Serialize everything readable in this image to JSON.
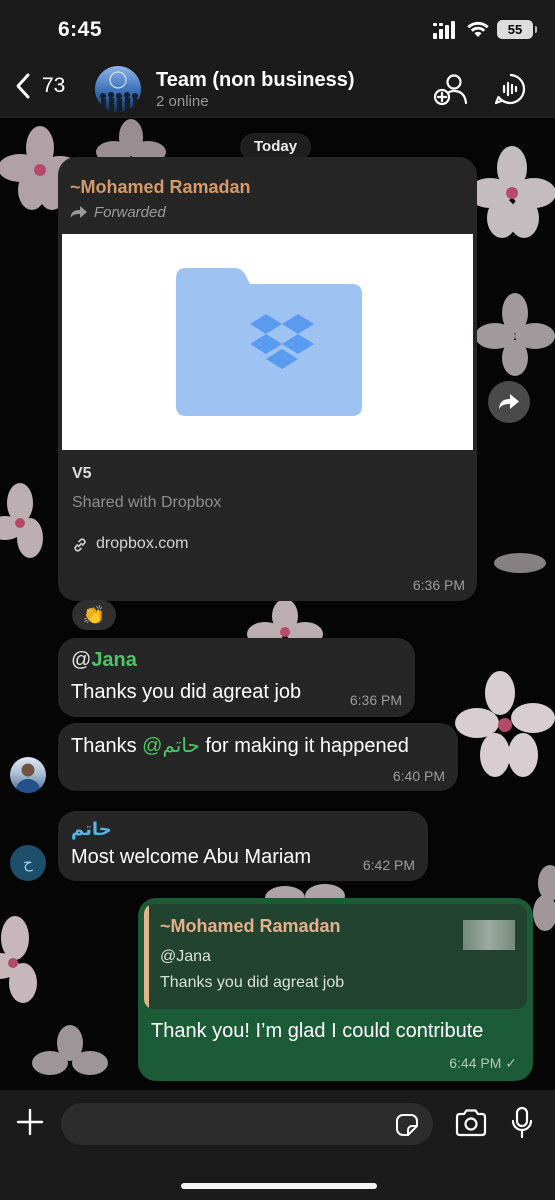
{
  "status_bar": {
    "time": "6:45",
    "battery": "55"
  },
  "header": {
    "back_count": "73",
    "title": "Team (non business)",
    "subtitle": "2 online"
  },
  "date_chip": "Today",
  "messages": {
    "forwarded": {
      "sender": "~Mohamed Ramadan",
      "forwarded_label": "Forwarded",
      "link_title": "V5",
      "link_description": "Shared with Dropbox",
      "link_domain": "dropbox.com",
      "time": "6:36 PM",
      "reaction": "👏"
    },
    "msg2": {
      "mention_at": "@",
      "mention_name": "Jana",
      "text": "Thanks you did agreat job",
      "time": "6:36 PM"
    },
    "msg3": {
      "text_before": "Thanks ",
      "mention": "@حاتم",
      "text_after": " for making it happened",
      "time": "6:40 PM"
    },
    "msg4": {
      "sender": "حاتم",
      "text": "Most welcome Abu Mariam",
      "time": "6:42 PM",
      "avatar_letter": "ح"
    },
    "msg5": {
      "reply_sender": "~Mohamed Ramadan",
      "reply_mention": "@Jana",
      "reply_text": "Thanks you did agreat job",
      "text": "Thank you! I’m glad I could contribute",
      "time": "6:44 PM ✓"
    }
  },
  "colors": {
    "header_bg": "#1b1b1b",
    "incoming_bubble": "#262626",
    "outgoing_bubble": "#1c5b37",
    "mention_green": "#4cc667",
    "sender_orange": "#d49a6a"
  }
}
